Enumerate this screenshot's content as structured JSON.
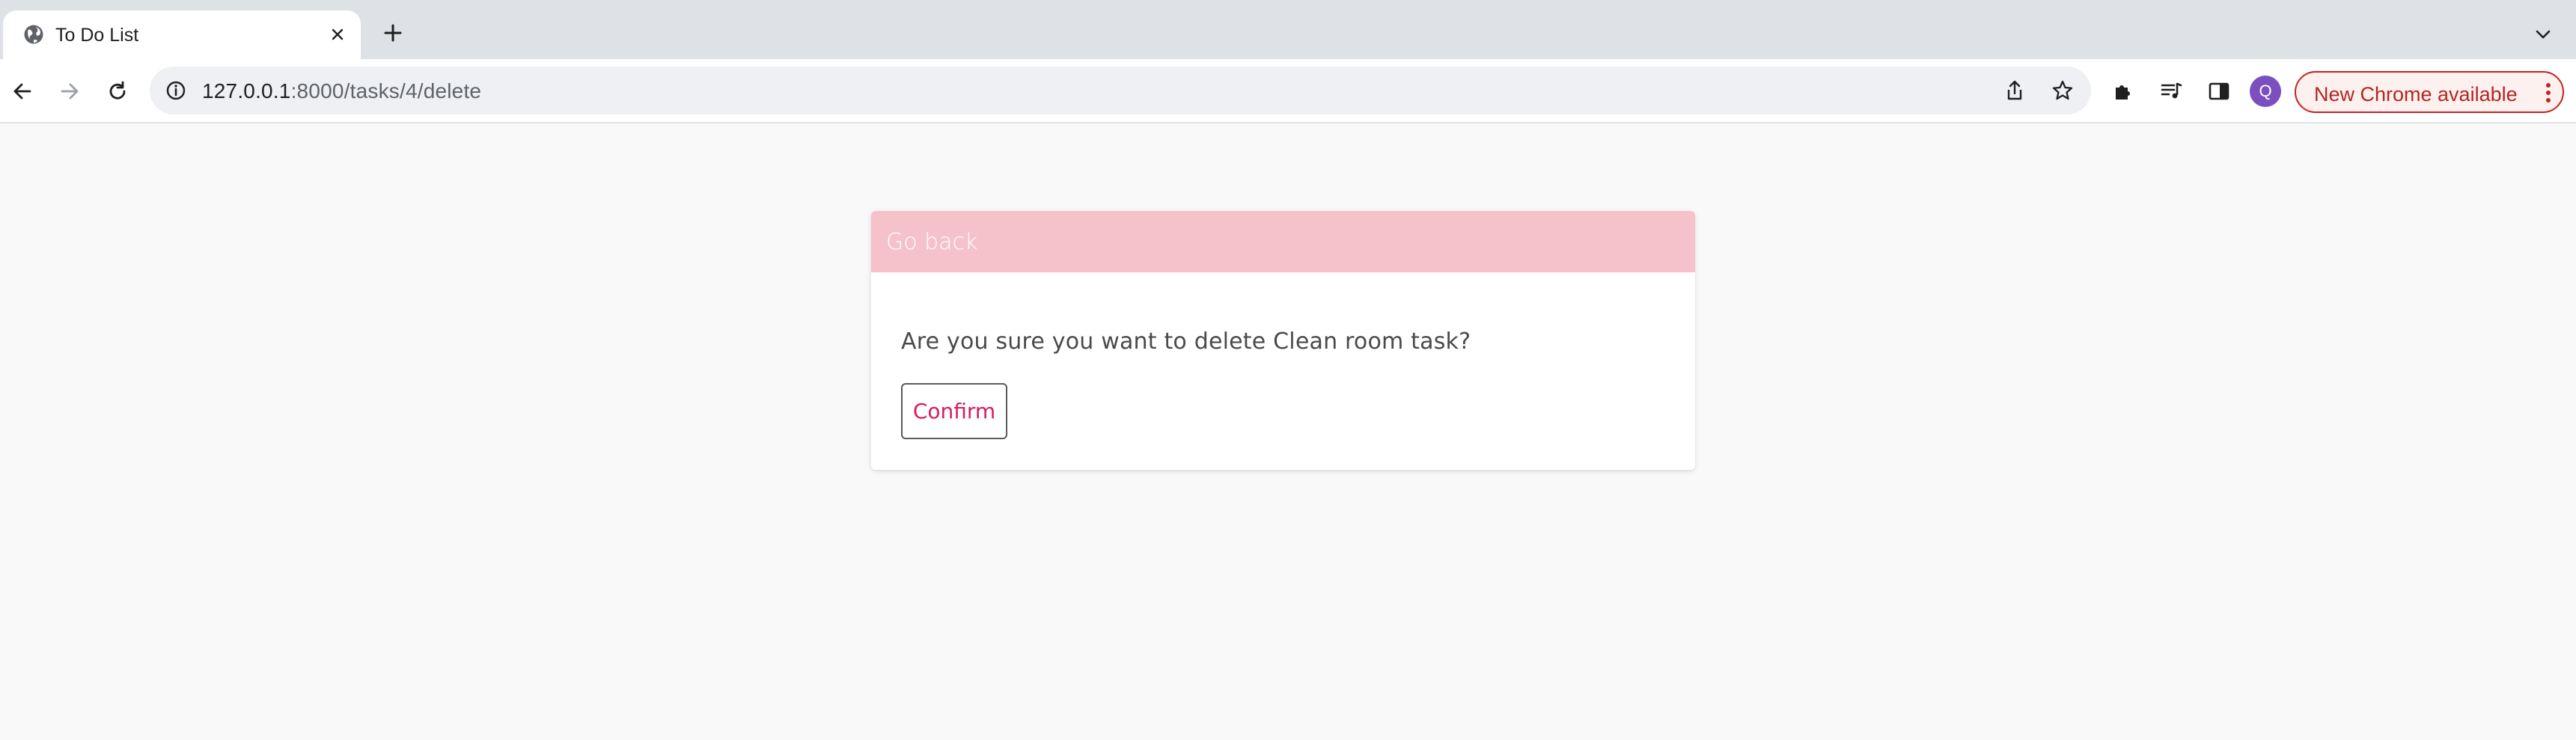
{
  "browser": {
    "tab": {
      "title": "To Do List",
      "favicon": "globe-icon"
    },
    "address_bar": {
      "host": "127.0.0.1",
      "path": ":8000/tasks/4/delete"
    },
    "profile": {
      "initial": "Q",
      "color": "#7b4fc0"
    },
    "update_chip": {
      "label": "New Chrome available",
      "color": "#c5221f"
    }
  },
  "page": {
    "back_link": "Go back",
    "question": "Are you sure you want to delete Clean room task?",
    "confirm_label": "Confirm",
    "colors": {
      "header": "#f5c2c9",
      "confirm_text": "#d81b60"
    }
  }
}
